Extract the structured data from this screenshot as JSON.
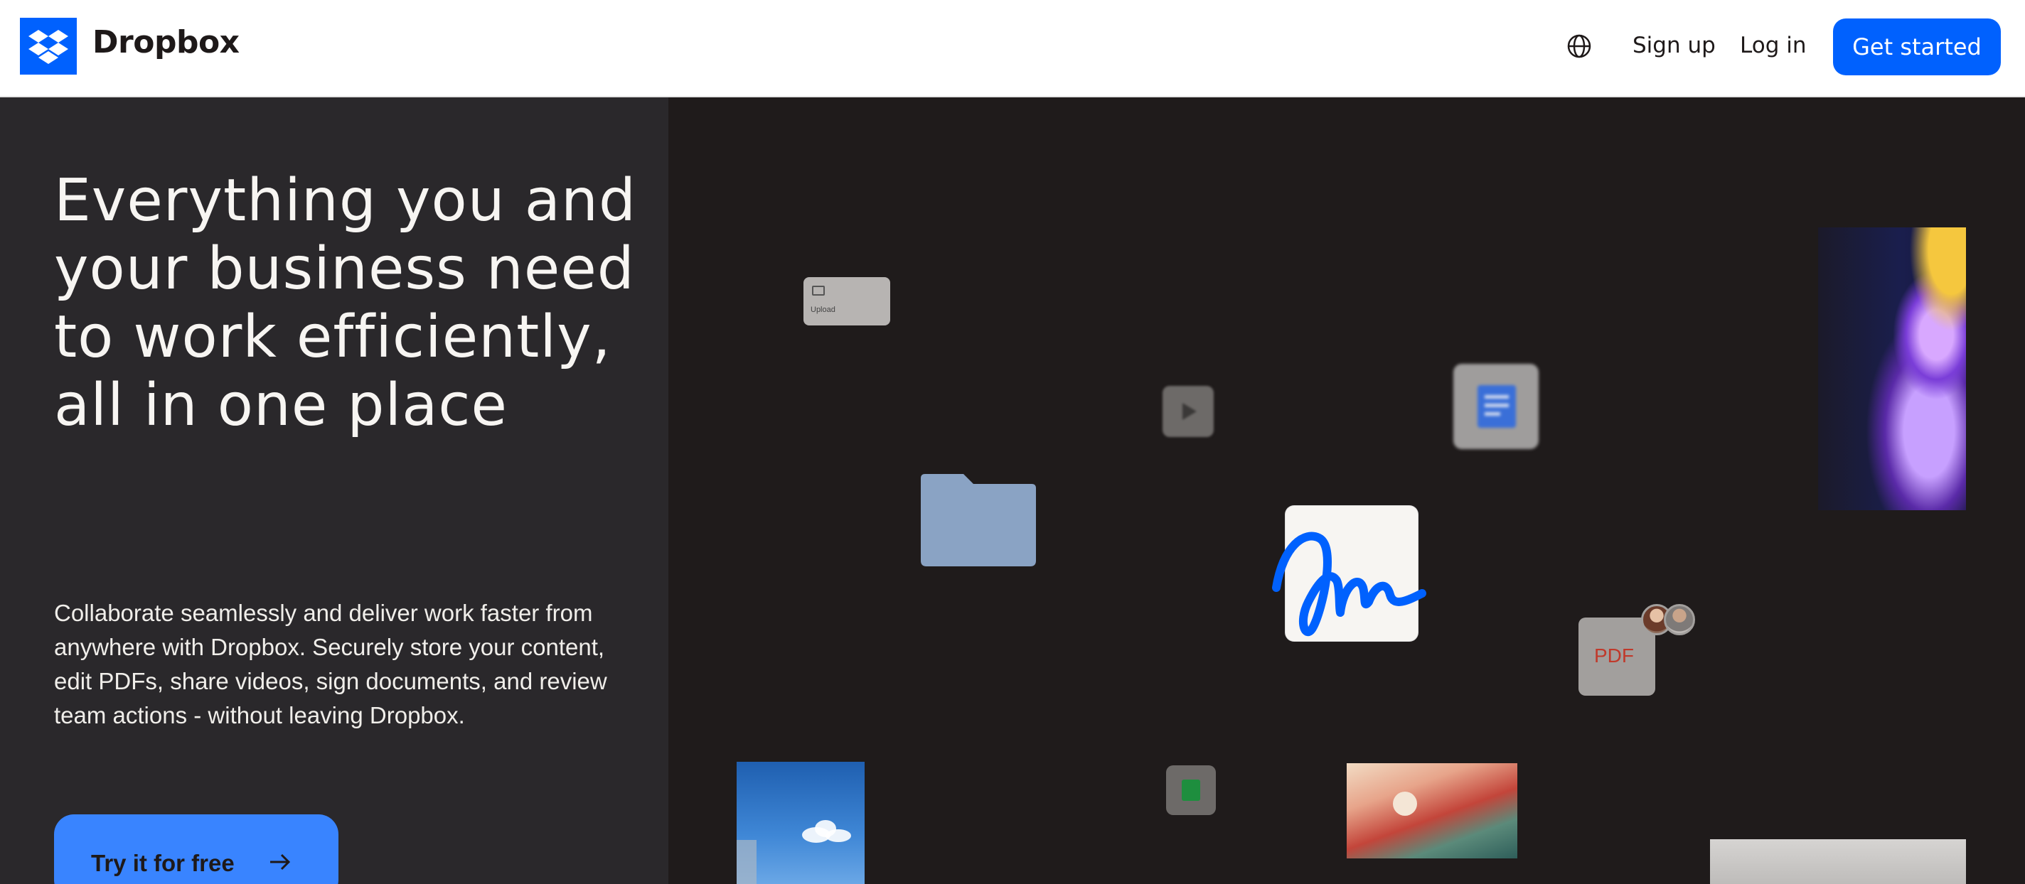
{
  "header": {
    "brand": "Dropbox",
    "language_icon": "globe-icon",
    "signup_label": "Sign up",
    "login_label": "Log in",
    "cta_label": "Get started"
  },
  "hero": {
    "headline": "Everything you and your business need to work efficiently, all in one place",
    "subtext": "Collaborate seamlessly and deliver work faster from anywhere with Dropbox. Securely store your content, edit PDFs, share videos, sign documents, and review team actions - without leaving Dropbox.",
    "try_label": "Try it for free",
    "try_icon": "arrow-right-icon"
  },
  "visuals": {
    "upload_label": "Upload",
    "pdf_label": "PDF"
  },
  "colors": {
    "brand_blue": "#0061fe",
    "try_blue": "#3984ff",
    "left_panel": "#2a282b",
    "right_panel": "#1f1b1b",
    "folder": "#8aa3c4",
    "signature": "#0061fe"
  }
}
